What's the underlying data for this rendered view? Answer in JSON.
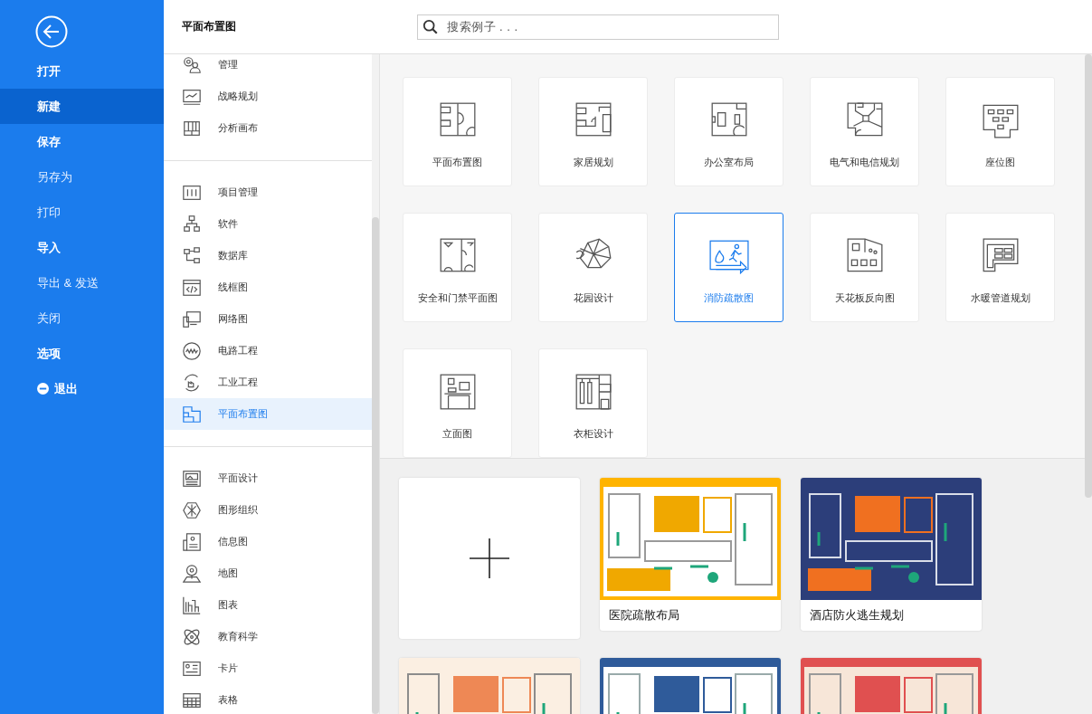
{
  "menu": [
    {
      "label": "打开",
      "emphasized": true,
      "selected": false,
      "kind": "plain"
    },
    {
      "label": "新建",
      "emphasized": true,
      "selected": true,
      "kind": "plain"
    },
    {
      "label": "保存",
      "emphasized": true,
      "selected": false,
      "kind": "plain"
    },
    {
      "label": "另存为",
      "emphasized": false,
      "selected": false,
      "kind": "plain"
    },
    {
      "label": "打印",
      "emphasized": false,
      "selected": false,
      "kind": "plain"
    },
    {
      "label": "导入",
      "emphasized": true,
      "selected": false,
      "kind": "plain"
    },
    {
      "label": "导出 & 发送",
      "emphasized": false,
      "selected": false,
      "kind": "plain"
    },
    {
      "label": "关闭",
      "emphasized": false,
      "selected": false,
      "kind": "plain"
    },
    {
      "label": "选项",
      "emphasized": true,
      "selected": false,
      "kind": "plain"
    },
    {
      "label": "退出",
      "emphasized": true,
      "selected": false,
      "kind": "exit"
    }
  ],
  "header": {
    "title": "平面布置图",
    "search": {
      "placeholder": "搜索例子 . . ."
    }
  },
  "categories": [
    {
      "items": [
        {
          "label": "管理",
          "selected": false
        },
        {
          "label": "战略规划",
          "selected": false
        },
        {
          "label": "分析画布",
          "selected": false
        }
      ]
    },
    {
      "items": [
        {
          "label": "项目管理",
          "selected": false
        },
        {
          "label": "软件",
          "selected": false
        },
        {
          "label": "数据库",
          "selected": false
        },
        {
          "label": "线框图",
          "selected": false
        },
        {
          "label": "网络图",
          "selected": false
        },
        {
          "label": "电路工程",
          "selected": false
        },
        {
          "label": "工业工程",
          "selected": false
        },
        {
          "label": "平面布置图",
          "selected": true
        }
      ]
    },
    {
      "items": [
        {
          "label": "平面设计",
          "selected": false
        },
        {
          "label": "图形组织",
          "selected": false
        },
        {
          "label": "信息图",
          "selected": false
        },
        {
          "label": "地图",
          "selected": false
        },
        {
          "label": "图表",
          "selected": false
        },
        {
          "label": "教育科学",
          "selected": false
        },
        {
          "label": "卡片",
          "selected": false
        },
        {
          "label": "表格",
          "selected": false
        }
      ]
    }
  ],
  "templates": [
    {
      "label": "平面布置图",
      "selected": false
    },
    {
      "label": "家居规划",
      "selected": false
    },
    {
      "label": "办公室布局",
      "selected": false
    },
    {
      "label": "电气和电信规划",
      "selected": false
    },
    {
      "label": "座位图",
      "selected": false
    },
    {
      "label": "安全和门禁平面图",
      "selected": false
    },
    {
      "label": "花园设计",
      "selected": false
    },
    {
      "label": "消防疏散图",
      "selected": true
    },
    {
      "label": "天花板反向图",
      "selected": false
    },
    {
      "label": "水暖管道规划",
      "selected": false
    },
    {
      "label": "立面图",
      "selected": false
    },
    {
      "label": "衣柜设计",
      "selected": false
    }
  ],
  "gallery": [
    {
      "kind": "new"
    },
    {
      "kind": "template",
      "title": "医院疏散布局"
    },
    {
      "kind": "template",
      "title": "酒店防火逃生规划"
    },
    {
      "kind": "template"
    },
    {
      "kind": "template"
    },
    {
      "kind": "template"
    }
  ]
}
